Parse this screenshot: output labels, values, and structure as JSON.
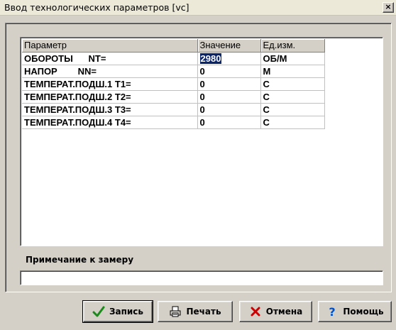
{
  "window": {
    "title": "Ввод технологических параметров [vc]",
    "close_label": "×"
  },
  "grid": {
    "columns": [
      "Параметр",
      "Значение",
      "Ед.изм."
    ],
    "rows": [
      {
        "param": "ОБОРОТЫ      NT=",
        "value": "2980",
        "unit": "ОБ/М",
        "selected": true
      },
      {
        "param": "НАПОР        NN=",
        "value": "0",
        "unit": "М"
      },
      {
        "param": "ТЕМПЕРАТ.ПОДШ.1 T1=",
        "value": "0",
        "unit": "С"
      },
      {
        "param": "ТЕМПЕРАТ.ПОДШ.2 T2=",
        "value": "0",
        "unit": "С"
      },
      {
        "param": "ТЕМПЕРАТ.ПОДШ.3 T3=",
        "value": "0",
        "unit": "С"
      },
      {
        "param": "ТЕМПЕРАТ.ПОДШ.4 T4=",
        "value": "0",
        "unit": "С"
      }
    ]
  },
  "note": {
    "label": "Примечание к замеру",
    "value": ""
  },
  "buttons": {
    "save": "Запись",
    "print": "Печать",
    "cancel": "Отмена",
    "help": "Помощь"
  },
  "icons": {
    "save": "checkmark-icon",
    "print": "printer-icon",
    "cancel": "cross-icon",
    "help": "question-icon"
  },
  "colors": {
    "selection": "#0a246a",
    "check": "#1a8a1a",
    "cross": "#cc0000",
    "help": "#0050c8"
  }
}
